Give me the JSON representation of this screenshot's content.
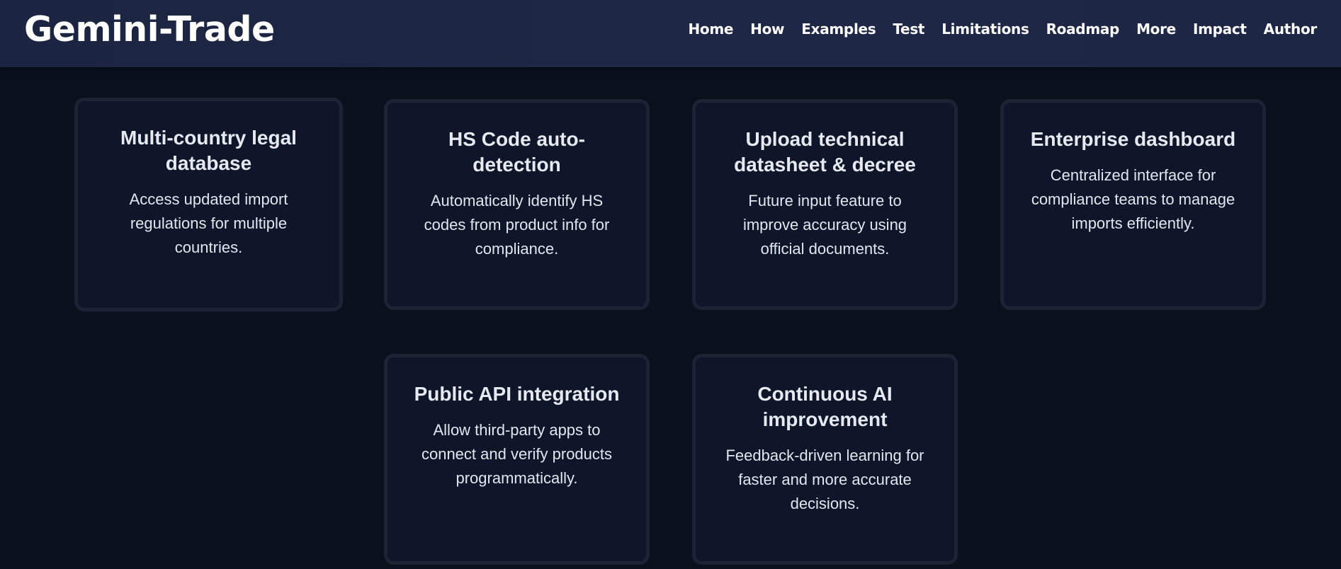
{
  "brand": "Gemini-Trade",
  "nav": [
    "Home",
    "How",
    "Examples",
    "Test",
    "Limitations",
    "Roadmap",
    "More",
    "Impact",
    "Author"
  ],
  "cards": [
    {
      "title": "Multi-country legal database",
      "description": "Access updated import regulations for multiple countries."
    },
    {
      "title": "HS Code auto-detection",
      "description": "Automatically identify HS codes from product info for compliance."
    },
    {
      "title": "Upload technical datasheet & decree",
      "description": "Future input feature to improve accuracy using official documents."
    },
    {
      "title": "Enterprise dashboard",
      "description": "Centralized interface for compliance teams to manage imports efficiently."
    },
    {
      "title": "Public API integration",
      "description": "Allow third-party apps to connect and verify products programmatically."
    },
    {
      "title": "Continuous AI improvement",
      "description": "Feedback-driven learning for faster and more accurate decisions."
    }
  ]
}
